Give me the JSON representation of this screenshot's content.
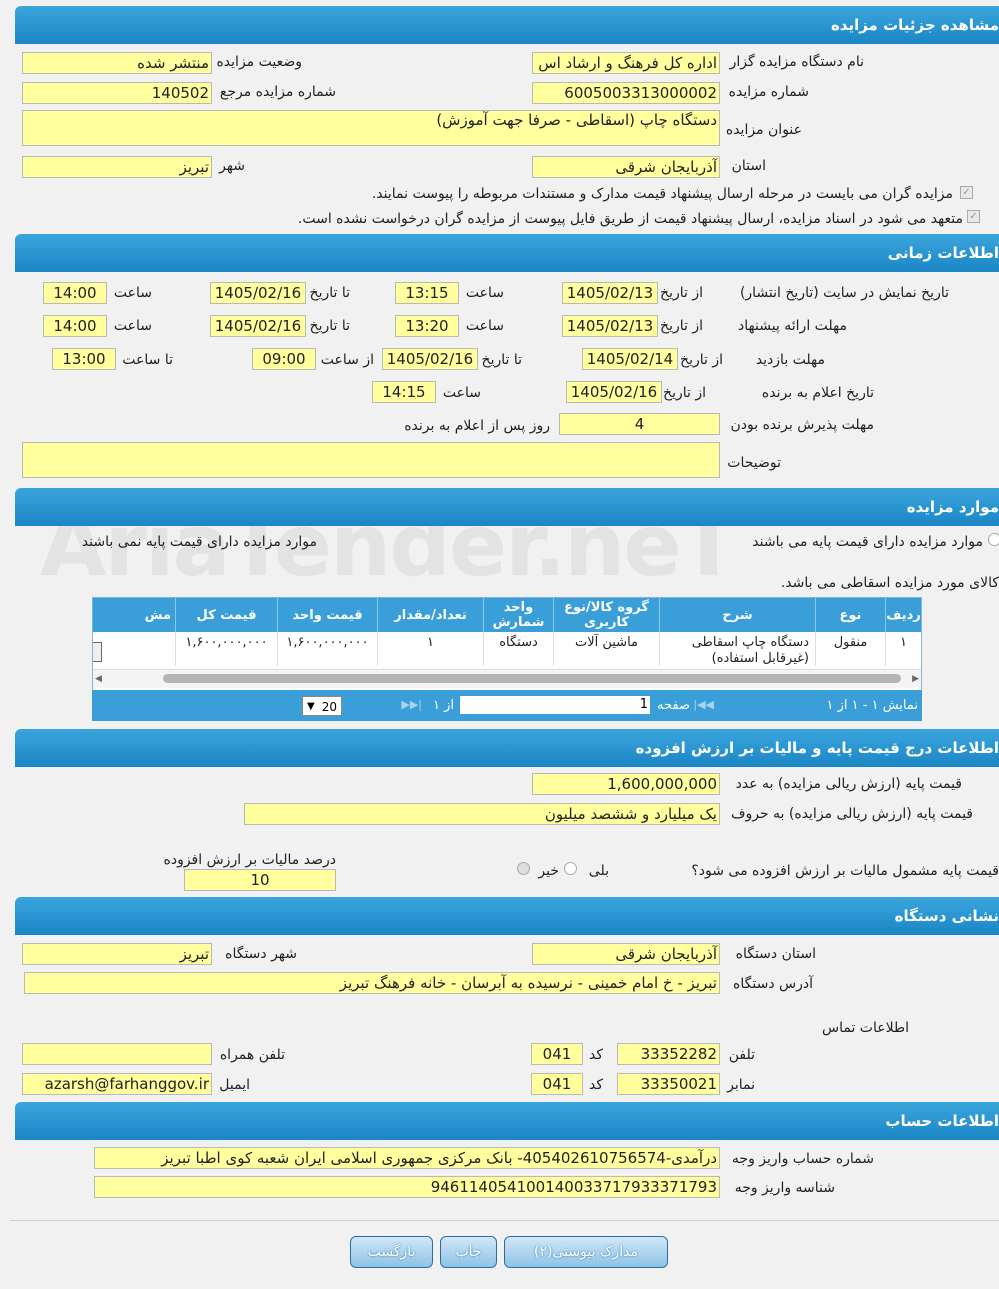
{
  "sections": {
    "details": "مشاهده جزئیات مزایده",
    "timing": "اطلاعات زمانی",
    "items": "موارد مزایده",
    "price": "اطلاعات درج قیمت پایه و مالیات بر ارزش افزوده",
    "address": "نشانی دستگاه",
    "account": "اطلاعات حساب"
  },
  "details": {
    "org_label": "نام دستگاه مزایده گزار",
    "org_value": "اداره کل فرهنگ و ارشاد اس",
    "status_label": "وضعیت مزایده",
    "status_value": "منتشر شده",
    "number_label": "شماره مزایده",
    "number_value": "6005003313000002",
    "ref_label": "شماره مزایده مرجع",
    "ref_value": "140502",
    "title_label": "عنوان مزایده",
    "title_value": "دستگاه چاپ (اسقاطی - صرفا  جهت آموزش)",
    "province_label": "استان",
    "province_value": "آذربایجان شرقی",
    "city_label": "شهر",
    "city_value": "تبریز",
    "check1": "مزایده گران می بایست در مرحله ارسال پیشنهاد قیمت مدارک و مستندات مربوطه را پیوست نمایند.",
    "check2": "متعهد می شود در اسناد مزایده، ارسال پیشنهاد قیمت از طریق فایل پیوست از مزایده گران درخواست نشده است."
  },
  "timing": {
    "row1_label": "تاریخ نمایش در سایت (تاریخ انتشار)",
    "row2_label": "مهلت ارائه پیشنهاد",
    "row3_label": "مهلت بازدید",
    "row4_label": "تاریخ اعلام به برنده",
    "row5_label": "مهلت پذیرش برنده بودن",
    "desc_label": "توضیحات",
    "from_date": "از تاریخ",
    "to_date": "تا تاریخ",
    "time": "ساعت",
    "from_time": "از ساعت",
    "to_time": "تا ساعت",
    "days_after": "روز پس از اعلام به برنده",
    "r1_from": "1405/02/13",
    "r1_from_time": "13:15",
    "r1_to": "1405/02/16",
    "r1_to_time": "14:00",
    "r2_from": "1405/02/13",
    "r2_from_time": "13:20",
    "r2_to": "1405/02/16",
    "r2_to_time": "14:00",
    "r3_from": "1405/02/14",
    "r3_to": "1405/02/16",
    "r3_from_time": "09:00",
    "r3_to_time": "13:00",
    "r4_from": "1405/02/16",
    "r4_time": "14:15",
    "r5_days": "4"
  },
  "items": {
    "radio_with_base": "موارد مزایده دارای قیمت پایه می باشند",
    "radio_without_base": "موارد مزایده دارای قیمت پایه نمی باشند",
    "note": "کالای مورد مزایده اسقاطی می باشد.",
    "columns": [
      "ردیف",
      "نوع",
      "شرح",
      "گروه کالا/نوع کاربری",
      "واحد شمارش",
      "تعداد/مقدار",
      "قیمت واحد",
      "قیمت کل",
      "مش"
    ],
    "rows": [
      [
        "۱",
        "منقول",
        "دستگاه چاپ اسقاطی (غیرقابل استفاده)",
        "ماشین آلات",
        "دستگاه",
        "۱",
        "۱,۶۰۰,۰۰۰,۰۰۰",
        "۱,۶۰۰,۰۰۰,۰۰۰",
        ""
      ]
    ],
    "pager": {
      "display": "نمایش ۱ - ۱ از ۱",
      "page_label": "صفحه",
      "page_value": "1",
      "of": "از ۱",
      "page_size": "20"
    }
  },
  "price": {
    "base_num_label": "قیمت پایه (ارزش ریالی مزایده) به عدد",
    "base_num_value": "1,600,000,000",
    "base_words_label": "قیمت پایه (ارزش ریالی مزایده) به حروف",
    "base_words_value": "یک میلیارد و ششصد میلیون",
    "vat_question": "قیمت پایه مشمول مالیات بر ارزش افزوده می شود؟",
    "yes": "بلی",
    "no": "خیر",
    "vat_percent_label": "درصد مالیات بر ارزش افزوده",
    "vat_percent_value": "10"
  },
  "address": {
    "province_label": "استان دستگاه",
    "province_value": "آذربایجان شرقی",
    "city_label": "شهر دستگاه",
    "city_value": "تبریز",
    "address_label": "آدرس دستگاه",
    "address_value": "تبریز - خ امام خمینی - نرسیده به آبرسان - خانه فرهنگ تبریز",
    "contact_label": "اطلاعات تماس",
    "phone_label": "تلفن",
    "phone_value": "33352282",
    "code_label": "کد",
    "phone_code": "041",
    "mobile_label": "تلفن همراه",
    "mobile_value": "",
    "fax_label": "نمابر",
    "fax_value": "33350021",
    "fax_code": "041",
    "email_label": "ایمیل",
    "email_value": "azarsh@farhanggov.ir"
  },
  "account": {
    "account_label": "شماره حساب واریز وجه",
    "account_value": "درآمدی-405402610756574- بانک مرکزی جمهوری اسلامی ایران شعبه کوی اطبا تبریز",
    "id_label": "شناسه واریز وجه",
    "id_value": "946114054100140033717933371793"
  },
  "buttons": {
    "attachments": "مدارک پیوستی(۲)",
    "print": "چاپ",
    "back": "بازگشت"
  },
  "watermark": "AriaTender.neT"
}
